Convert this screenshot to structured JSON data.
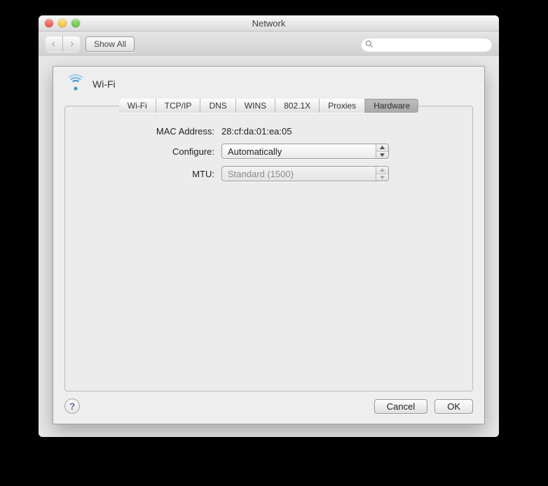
{
  "window": {
    "title": "Network"
  },
  "toolbar": {
    "show_all": "Show All",
    "search_placeholder": ""
  },
  "sheet": {
    "connection_name": "Wi-Fi",
    "tabs": [
      "Wi-Fi",
      "TCP/IP",
      "DNS",
      "WINS",
      "802.1X",
      "Proxies",
      "Hardware"
    ],
    "selected_tab_index": 6,
    "hardware": {
      "mac_label": "MAC Address:",
      "mac_value": "28:cf:da:01:ea:05",
      "configure_label": "Configure:",
      "configure_value": "Automatically",
      "mtu_label": "MTU:",
      "mtu_value": "Standard  (1500)",
      "mtu_enabled": false
    },
    "buttons": {
      "cancel": "Cancel",
      "ok": "OK"
    }
  }
}
